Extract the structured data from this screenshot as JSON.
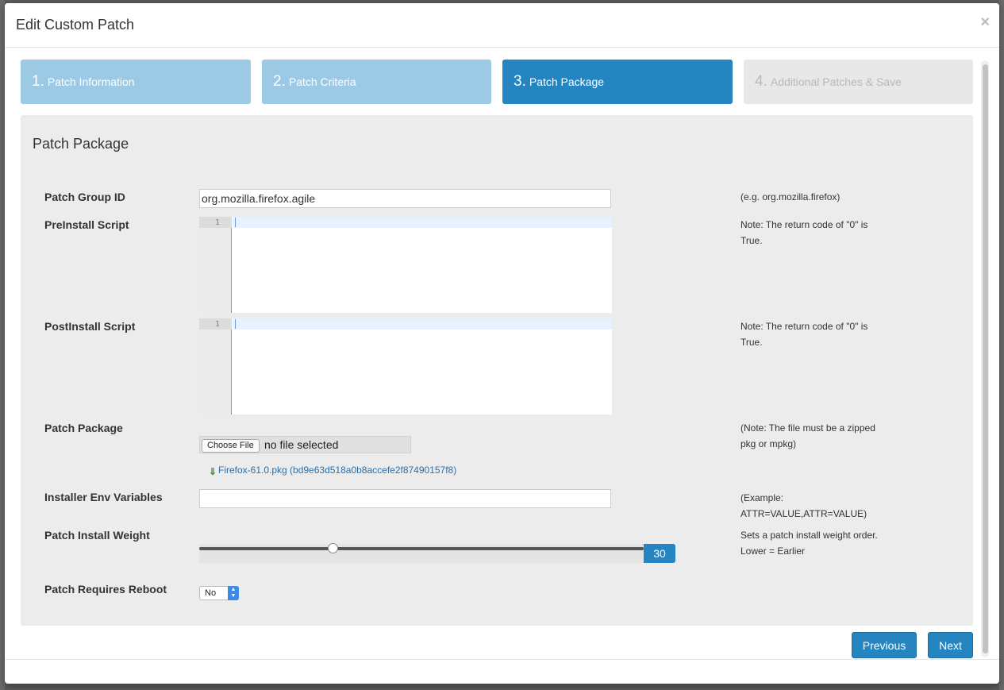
{
  "modal": {
    "title": "Edit Custom Patch",
    "close_symbol": "×"
  },
  "steps": [
    {
      "number": "1.",
      "label": "Patch Information",
      "state": "done"
    },
    {
      "number": "2.",
      "label": "Patch Criteria",
      "state": "done"
    },
    {
      "number": "3.",
      "label": "Patch Package",
      "state": "active"
    },
    {
      "number": "4.",
      "label": "Additional Patches & Save",
      "state": "todo"
    }
  ],
  "panel": {
    "title": "Patch Package"
  },
  "form": {
    "group_id": {
      "label": "Patch Group ID",
      "value": "org.mozilla.firefox.agile",
      "help": "(e.g. org.mozilla.firefox)"
    },
    "preinstall": {
      "label": "PreInstall Script",
      "line_number": "1",
      "help": "Note: The return code of \"0\" is True."
    },
    "postinstall": {
      "label": "PostInstall Script",
      "line_number": "1",
      "help": "Note: The return code of \"0\" is True."
    },
    "package": {
      "label": "Patch Package",
      "choose_button": "Choose File",
      "file_status": "no file selected",
      "current_file": "Firefox-61.0.pkg (bd9e63d518a0b8accefe2f87490157f8)",
      "download_icon": "down-arrow-icon",
      "help": "(Note: The file must be a zipped pkg or mpkg)"
    },
    "env_vars": {
      "label": "Installer Env Variables",
      "value": "",
      "help": "(Example: ATTR=VALUE,ATTR=VALUE)"
    },
    "weight": {
      "label": "Patch Install Weight",
      "value": "30",
      "slider_fraction": 0.3,
      "help_line1": "Sets a patch install weight order.",
      "help_line2": "Lower = Earlier"
    },
    "reboot": {
      "label": "Patch Requires Reboot",
      "selected": "No"
    }
  },
  "buttons": {
    "previous": "Previous",
    "next": "Next"
  },
  "colors": {
    "accent": "#2585c1",
    "step_done": "#9cc9e4",
    "step_todo": "#e8e8e8",
    "panel_bg": "#ececec"
  }
}
